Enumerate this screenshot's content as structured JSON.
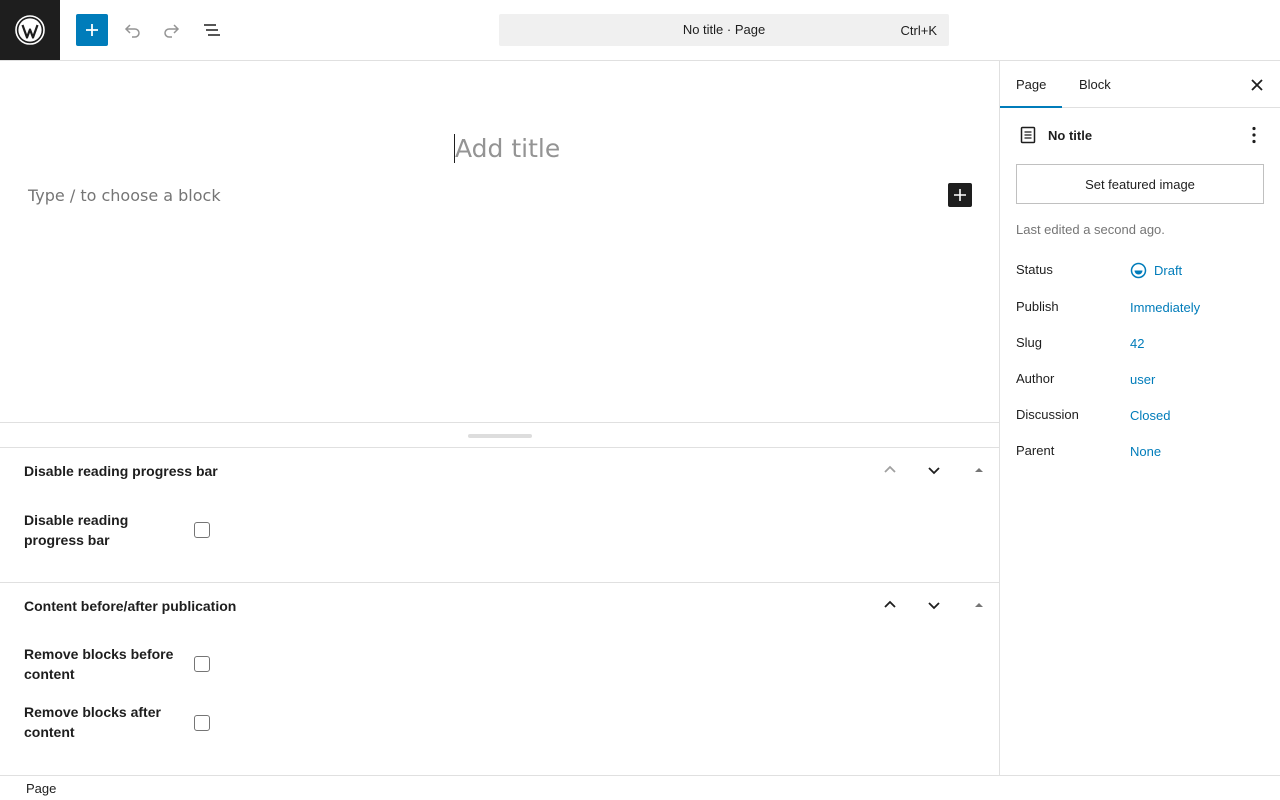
{
  "header": {
    "command_title": "No title · Page",
    "command_shortcut": "Ctrl+K"
  },
  "editor": {
    "title_placeholder": "Add title",
    "block_placeholder": "Type / to choose a block"
  },
  "metaboxes": [
    {
      "title": "Disable reading progress bar",
      "fields": [
        {
          "label": "Disable reading progress bar",
          "checked": false
        }
      ]
    },
    {
      "title": "Content before/after publication",
      "fields": [
        {
          "label": "Remove blocks before content",
          "checked": false
        },
        {
          "label": "Remove blocks after content",
          "checked": false
        }
      ]
    }
  ],
  "sidebar": {
    "tabs": [
      "Page",
      "Block"
    ],
    "active_tab": "Page",
    "doc_title": "No title",
    "featured_image_label": "Set featured image",
    "last_edited": "Last edited a second ago.",
    "properties": [
      {
        "label": "Status",
        "value": "Draft"
      },
      {
        "label": "Publish",
        "value": "Immediately"
      },
      {
        "label": "Slug",
        "value": "42"
      },
      {
        "label": "Author",
        "value": "user"
      },
      {
        "label": "Discussion",
        "value": "Closed"
      },
      {
        "label": "Parent",
        "value": "None"
      }
    ]
  },
  "footer": {
    "breadcrumb": "Page"
  },
  "colors": {
    "accent": "#007cba",
    "dark": "#1e1e1e",
    "border": "#e0e0e0"
  }
}
